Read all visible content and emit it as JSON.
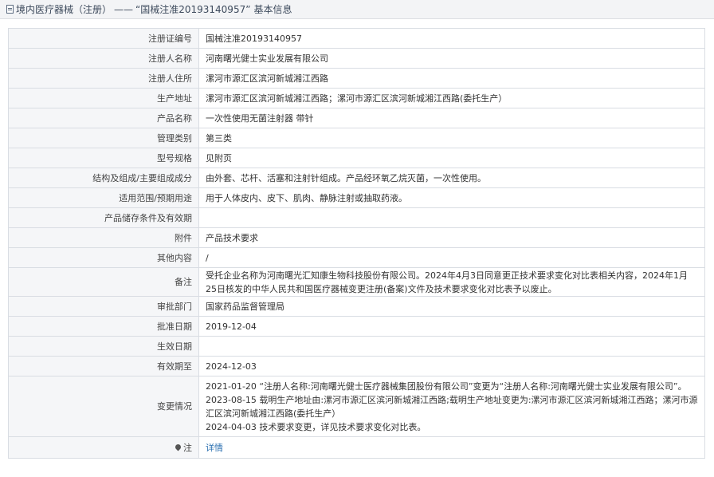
{
  "header": {
    "category": "境内医疗器械（注册）",
    "separator": "——",
    "record_title": "“国械注准20193140957”",
    "suffix": "基本信息"
  },
  "fields": [
    {
      "label": "注册证编号",
      "value": "国械注准20193140957"
    },
    {
      "label": "注册人名称",
      "value": "河南曙光健士实业发展有限公司"
    },
    {
      "label": "注册人住所",
      "value": "漯河市源汇区滨河新城湘江西路"
    },
    {
      "label": "生产地址",
      "value": "漯河市源汇区滨河新城湘江西路；漯河市源汇区滨河新城湘江西路(委托生产）"
    },
    {
      "label": "产品名称",
      "value": "一次性使用无菌注射器 带针"
    },
    {
      "label": "管理类别",
      "value": "第三类"
    },
    {
      "label": "型号规格",
      "value": "见附页"
    },
    {
      "label": "结构及组成/主要组成成分",
      "value": "由外套、芯杆、活塞和注射针组成。产品经环氧乙烷灭菌，一次性使用。"
    },
    {
      "label": "适用范围/预期用途",
      "value": "用于人体皮内、皮下、肌肉、静脉注射或抽取药液。"
    },
    {
      "label": "产品储存条件及有效期",
      "value": ""
    },
    {
      "label": "附件",
      "value": "产品技术要求"
    },
    {
      "label": "其他内容",
      "value": "/"
    },
    {
      "label": "备注",
      "value": "受托企业名称为河南曙光汇知康生物科技股份有限公司。2024年4月3日同意更正技术要求变化对比表相关内容，2024年1月25日核发的中华人民共和国医疗器械变更注册(备案)文件及技术要求变化对比表予以废止。"
    },
    {
      "label": "审批部门",
      "value": "国家药品监督管理局"
    },
    {
      "label": "批准日期",
      "value": "2019-12-04"
    },
    {
      "label": "生效日期",
      "value": ""
    },
    {
      "label": "有效期至",
      "value": "2024-12-03"
    }
  ],
  "changes": {
    "label": "变更情况",
    "lines": [
      "2021-01-20 “注册人名称:河南曙光健士医疗器械集团股份有限公司”变更为“注册人名称:河南曙光健士实业发展有限公司”。",
      "2023-08-15 载明生产地址由:漯河市源汇区滨河新城湘江西路;载明生产地址变更为:漯河市源汇区滨河新城湘江西路；漯河市源汇区滨河新城湘江西路(委托生产）",
      "2024-04-03 技术要求变更，详见技术要求变化对比表。"
    ]
  },
  "note": {
    "label": "注",
    "link_text": "详情",
    "icon": "pin-icon"
  }
}
